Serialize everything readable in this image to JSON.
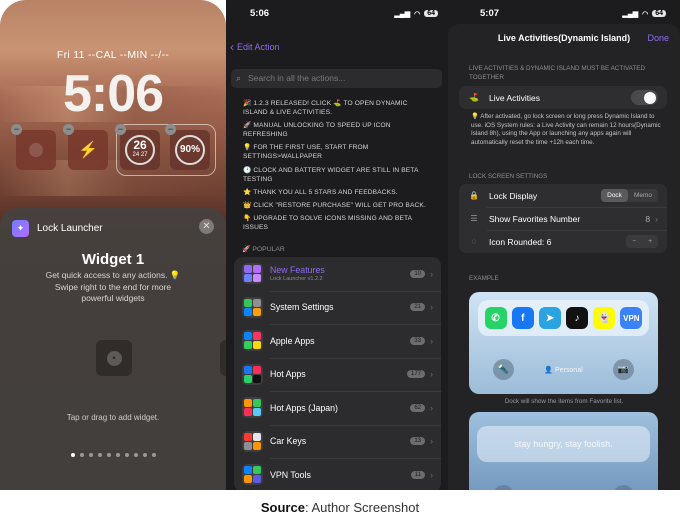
{
  "lock_screen": {
    "date_line": "Fri 11  --CAL --MIN --/--",
    "time": "5:06",
    "widgets": {
      "gauge1_value": "26",
      "gauge1_sub": "24  27",
      "gauge2_value": "90%"
    },
    "sheet": {
      "app_name": "Lock Launcher",
      "title": "Widget 1",
      "description": "Get quick access to any actions. 💡 Swipe right to the end for more powerful widgets",
      "hint": "Tap or drag to add widget.",
      "page_count": 10,
      "active_page": 0
    }
  },
  "edit_action": {
    "status_time": "5:06",
    "battery": "64",
    "back_label": "Edit Action",
    "search_placeholder": "Search in all the actions...",
    "notes": [
      "🎉 1.2.3 RELEASED! CLICK ⛳ TO OPEN DYNAMIC ISLAND & LIVE ACTIVITIES.",
      "🚀 MANUAL UNLOCKING TO SPEED UP ICON REFRESHING",
      "💡 FOR THE FIRST USE, START FROM SETTINGS>WALLPAPER",
      "🕐 CLOCK AND BATTERY WIDGET ARE STILL IN BETA TESTING",
      "⭐ THANK YOU ALL 5 STARS AND FEEDBACKS.",
      "👑 CLICK \"RESTORE PURCHASE\" WILL GET PRO BACK.",
      "👇 UPGRADE TO SOLVE ICONS MISSING AND BETA ISSUES"
    ],
    "section_header": "🚀 POPULAR",
    "rows": [
      {
        "title": "New Features",
        "subtitle": "Lock Launcher v1.2.2",
        "count": "10",
        "highlight": true
      },
      {
        "title": "System Settings",
        "subtitle": "",
        "count": "21",
        "highlight": false
      },
      {
        "title": "Apple Apps",
        "subtitle": "",
        "count": "33",
        "highlight": false
      },
      {
        "title": "Hot Apps",
        "subtitle": "",
        "count": "177",
        "highlight": false
      },
      {
        "title": "Hot Apps (Japan)",
        "subtitle": "",
        "count": "62",
        "highlight": false
      },
      {
        "title": "Car Keys",
        "subtitle": "",
        "count": "13",
        "highlight": false
      },
      {
        "title": "VPN Tools",
        "subtitle": "",
        "count": "11",
        "highlight": false
      }
    ]
  },
  "live_activities": {
    "status_time": "5:07",
    "battery": "64",
    "title": "Live Activities(Dynamic Island)",
    "done_label": "Done",
    "must_activate_header": "LIVE ACTIVITIES & DYNAMIC ISLAND MUST BE ACTIVATED TOGETHER",
    "toggle_label": "Live Activities",
    "info_text": "💡 After activated, go lock screen or long press Dynamic Island to use. iOS System rules: a Live Activity can remain 12 hours(Dynamic Island 8h), using the App or launching any apps again will automatically reset the time +12h each time.",
    "settings_header": "LOCK SCREEN SETTINGS",
    "lock_display_label": "Lock Display",
    "seg_options": [
      "Dock",
      "Memo"
    ],
    "show_fav_label": "Show Favorites Number",
    "show_fav_value": "8",
    "icon_rounded_label": "Icon Rounded: 6",
    "example_header": "EXAMPLE",
    "personal_label": "Personal",
    "dock_caption": "Dock will show the items from Favorite list.",
    "memo_text": "stay hungry, stay foolish."
  },
  "caption": {
    "bold": "Source",
    "rest": ": Author Screenshot"
  },
  "colors": {
    "accent": "#8f6bf0",
    "sheet_bg": "#46423f",
    "dark_bg": "#1c1c1e"
  }
}
